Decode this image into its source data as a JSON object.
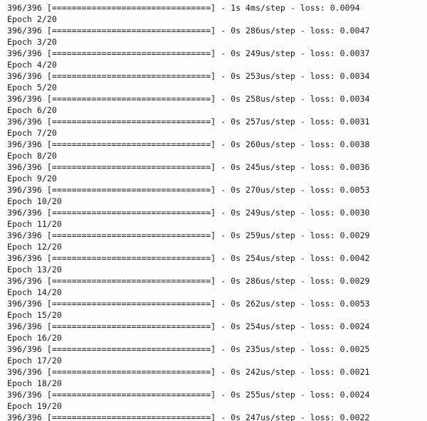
{
  "terminal": {
    "background_color": "#fdfdfd",
    "text_color": "#1b1b1b",
    "font_size_px": 11.6,
    "line_height_px": 16,
    "total_epochs": 20,
    "steps_per_epoch": "396/396",
    "progress_bar": "[================================]"
  },
  "lines": [
    {
      "id": "line-01",
      "kind": "progress",
      "text": "396/396 [================================] - 1s 4ms/step - loss: 0.0094"
    },
    {
      "id": "line-02",
      "kind": "epoch",
      "text": "Epoch 2/20"
    },
    {
      "id": "line-03",
      "kind": "progress",
      "text": "396/396 [================================] - 0s 286us/step - loss: 0.0047"
    },
    {
      "id": "line-04",
      "kind": "epoch",
      "text": "Epoch 3/20"
    },
    {
      "id": "line-05",
      "kind": "progress",
      "text": "396/396 [================================] - 0s 249us/step - loss: 0.0037"
    },
    {
      "id": "line-06",
      "kind": "epoch",
      "text": "Epoch 4/20"
    },
    {
      "id": "line-07",
      "kind": "progress",
      "text": "396/396 [================================] - 0s 253us/step - loss: 0.0034"
    },
    {
      "id": "line-08",
      "kind": "epoch",
      "text": "Epoch 5/20"
    },
    {
      "id": "line-09",
      "kind": "progress",
      "text": "396/396 [================================] - 0s 258us/step - loss: 0.0034"
    },
    {
      "id": "line-10",
      "kind": "epoch",
      "text": "Epoch 6/20"
    },
    {
      "id": "line-11",
      "kind": "progress",
      "text": "396/396 [================================] - 0s 257us/step - loss: 0.0031"
    },
    {
      "id": "line-12",
      "kind": "epoch",
      "text": "Epoch 7/20"
    },
    {
      "id": "line-13",
      "kind": "progress",
      "text": "396/396 [================================] - 0s 260us/step - loss: 0.0038"
    },
    {
      "id": "line-14",
      "kind": "epoch",
      "text": "Epoch 8/20"
    },
    {
      "id": "line-15",
      "kind": "progress",
      "text": "396/396 [================================] - 0s 245us/step - loss: 0.0036"
    },
    {
      "id": "line-16",
      "kind": "epoch",
      "text": "Epoch 9/20"
    },
    {
      "id": "line-17",
      "kind": "progress",
      "text": "396/396 [================================] - 0s 270us/step - loss: 0.0053"
    },
    {
      "id": "line-18",
      "kind": "epoch",
      "text": "Epoch 10/20"
    },
    {
      "id": "line-19",
      "kind": "progress",
      "text": "396/396 [================================] - 0s 249us/step - loss: 0.0030"
    },
    {
      "id": "line-20",
      "kind": "epoch",
      "text": "Epoch 11/20"
    },
    {
      "id": "line-21",
      "kind": "progress",
      "text": "396/396 [================================] - 0s 259us/step - loss: 0.0029"
    },
    {
      "id": "line-22",
      "kind": "epoch",
      "text": "Epoch 12/20"
    },
    {
      "id": "line-23",
      "kind": "progress",
      "text": "396/396 [================================] - 0s 254us/step - loss: 0.0042"
    },
    {
      "id": "line-24",
      "kind": "epoch",
      "text": "Epoch 13/20"
    },
    {
      "id": "line-25",
      "kind": "progress",
      "text": "396/396 [================================] - 0s 286us/step - loss: 0.0029"
    },
    {
      "id": "line-26",
      "kind": "epoch",
      "text": "Epoch 14/20"
    },
    {
      "id": "line-27",
      "kind": "progress",
      "text": "396/396 [================================] - 0s 262us/step - loss: 0.0053"
    },
    {
      "id": "line-28",
      "kind": "epoch",
      "text": "Epoch 15/20"
    },
    {
      "id": "line-29",
      "kind": "progress",
      "text": "396/396 [================================] - 0s 254us/step - loss: 0.0024"
    },
    {
      "id": "line-30",
      "kind": "epoch",
      "text": "Epoch 16/20"
    },
    {
      "id": "line-31",
      "kind": "progress",
      "text": "396/396 [================================] - 0s 235us/step - loss: 0.0025"
    },
    {
      "id": "line-32",
      "kind": "epoch",
      "text": "Epoch 17/20"
    },
    {
      "id": "line-33",
      "kind": "progress",
      "text": "396/396 [================================] - 0s 242us/step - loss: 0.0021"
    },
    {
      "id": "line-34",
      "kind": "epoch",
      "text": "Epoch 18/20"
    },
    {
      "id": "line-35",
      "kind": "progress",
      "text": "396/396 [================================] - 0s 255us/step - loss: 0.0024"
    },
    {
      "id": "line-36",
      "kind": "epoch",
      "text": "Epoch 19/20"
    },
    {
      "id": "line-37",
      "kind": "clipped",
      "text": "396/396 [================================] - 0s 247us/step - loss: 0.0022"
    }
  ],
  "training_summary": {
    "framework_style": "keras-progbar",
    "epochs_shown": [
      1,
      2,
      3,
      4,
      5,
      6,
      7,
      8,
      9,
      10,
      11,
      12,
      13,
      14,
      15,
      16,
      17,
      18,
      19
    ],
    "losses": [
      0.0094,
      0.0047,
      0.0037,
      0.0034,
      0.0034,
      0.0031,
      0.0038,
      0.0036,
      0.0053,
      0.003,
      0.0029,
      0.0042,
      0.0029,
      0.0053,
      0.0024,
      0.0025,
      0.0021,
      0.0024,
      0.0022
    ],
    "step_times": [
      "4ms",
      "286us",
      "249us",
      "253us",
      "258us",
      "257us",
      "260us",
      "245us",
      "270us",
      "249us",
      "259us",
      "254us",
      "286us",
      "262us",
      "254us",
      "235us",
      "242us",
      "255us",
      "247us"
    ],
    "epoch_durations": [
      "1s",
      "0s",
      "0s",
      "0s",
      "0s",
      "0s",
      "0s",
      "0s",
      "0s",
      "0s",
      "0s",
      "0s",
      "0s",
      "0s",
      "0s",
      "0s",
      "0s",
      "0s",
      "0s"
    ]
  }
}
